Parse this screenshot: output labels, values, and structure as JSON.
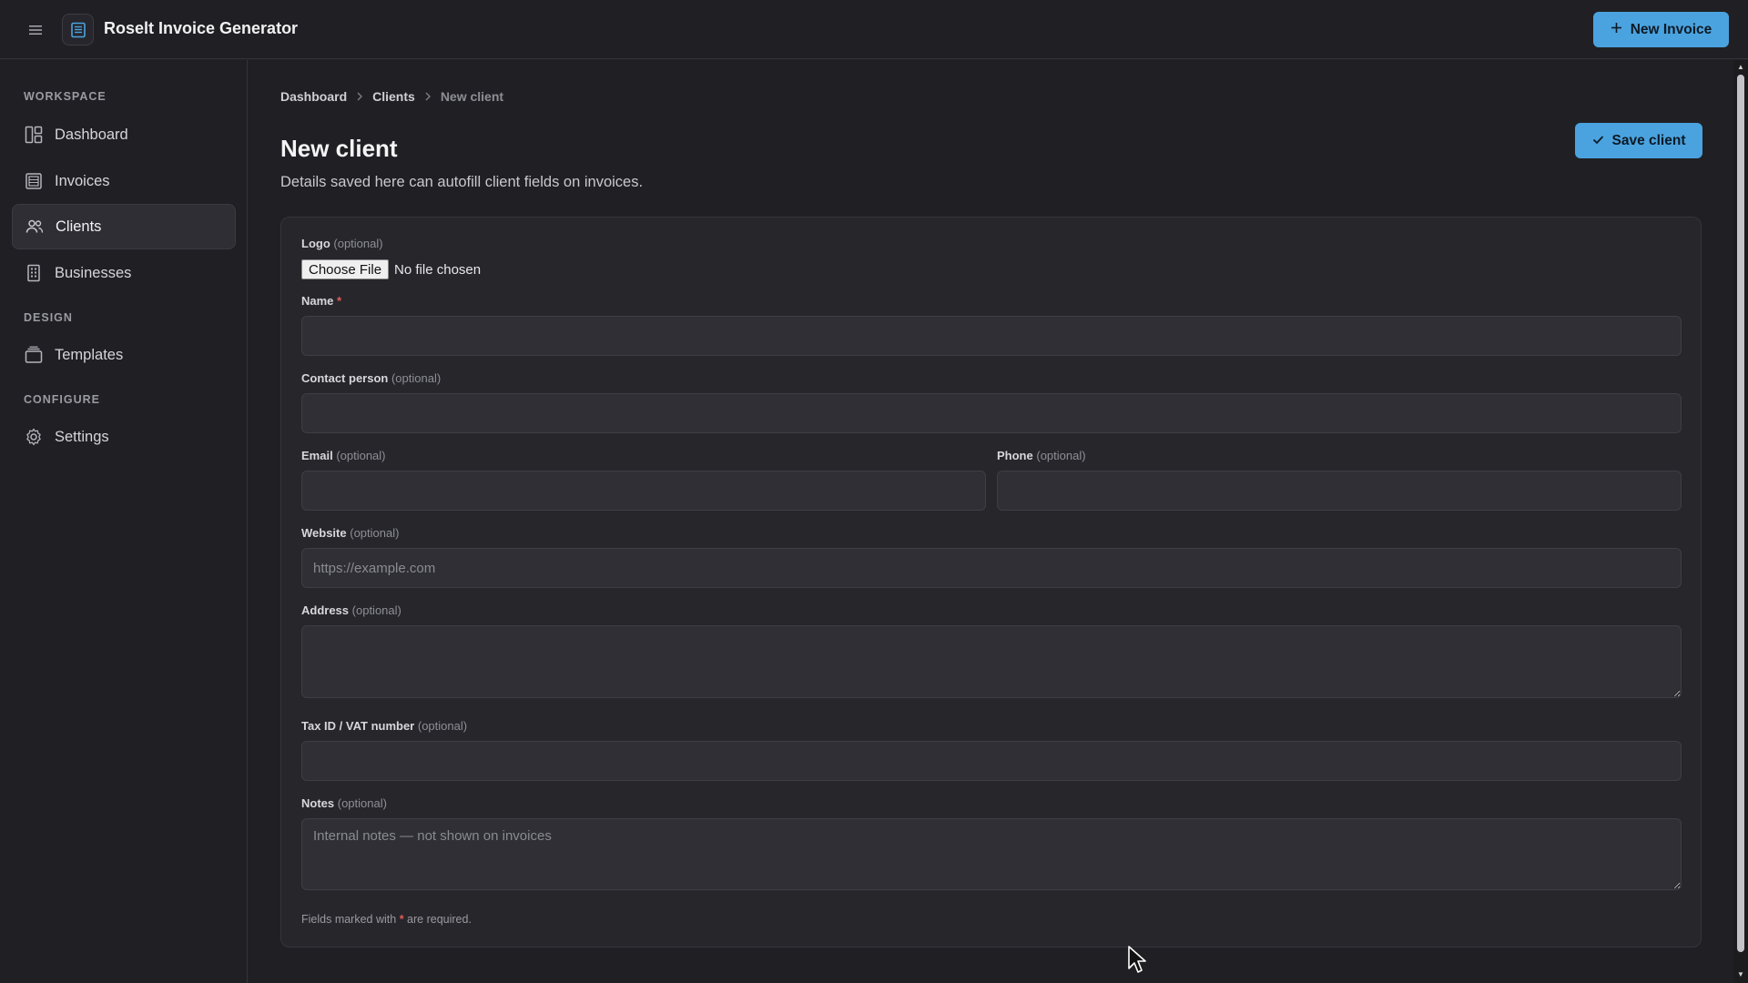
{
  "header": {
    "app_title": "Roselt Invoice Generator",
    "new_invoice_label": "New Invoice",
    "menu_icon": "hamburger-icon",
    "logo_icon": "invoice-app-icon"
  },
  "sidebar": {
    "sections": [
      {
        "title": "WORKSPACE"
      },
      {
        "title": "DESIGN"
      },
      {
        "title": "CONFIGURE"
      }
    ],
    "items": [
      {
        "label": "Dashboard",
        "icon": "dashboard-icon"
      },
      {
        "label": "Invoices",
        "icon": "invoice-icon"
      },
      {
        "label": "Clients",
        "icon": "users-icon",
        "active": true
      },
      {
        "label": "Businesses",
        "icon": "building-icon"
      },
      {
        "label": "Templates",
        "icon": "templates-icon"
      },
      {
        "label": "Settings",
        "icon": "gear-icon"
      }
    ]
  },
  "breadcrumb": [
    "Dashboard",
    "Clients",
    "New client"
  ],
  "page": {
    "title": "New client",
    "subtitle": "Details saved here can autofill client fields on invoices.",
    "save_label": "Save client"
  },
  "form": {
    "optional_tag": "(optional)",
    "logo": {
      "label": "Logo",
      "choose_label": "Choose File",
      "file_status": "No file chosen"
    },
    "name": {
      "label": "Name",
      "required_mark": "*",
      "value": "",
      "placeholder": ""
    },
    "contact": {
      "label": "Contact person",
      "value": "",
      "placeholder": ""
    },
    "email": {
      "label": "Email",
      "value": "",
      "placeholder": ""
    },
    "phone": {
      "label": "Phone",
      "value": "",
      "placeholder": ""
    },
    "website": {
      "label": "Website",
      "value": "",
      "placeholder": "https://example.com"
    },
    "address": {
      "label": "Address",
      "value": "",
      "placeholder": ""
    },
    "tax": {
      "label": "Tax ID / VAT number",
      "value": "",
      "placeholder": ""
    },
    "notes": {
      "label": "Notes",
      "value": "",
      "placeholder": "Internal notes — not shown on invoices"
    },
    "footnote_pre": "Fields marked with",
    "footnote_mark": "*",
    "footnote_post": "are required."
  },
  "colors": {
    "accent": "#4aa3df",
    "background": "#202024",
    "card": "#26262b",
    "required": "#e05a5a"
  }
}
